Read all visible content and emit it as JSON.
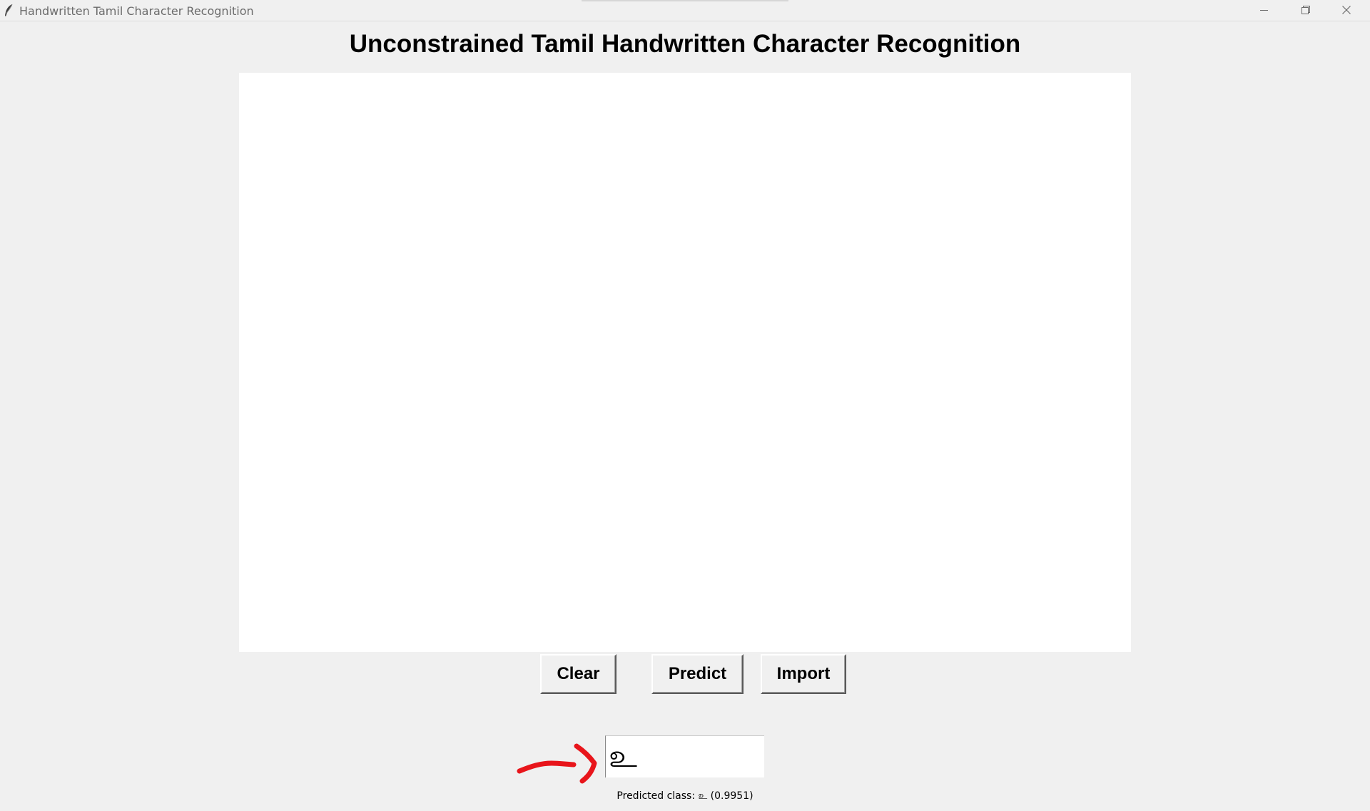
{
  "window": {
    "title": "Handwritten Tamil Character Recognition",
    "controls": [
      "minimize-icon",
      "restore-icon",
      "close-icon"
    ]
  },
  "heading": "Unconstrained Tamil Handwritten Character Recognition",
  "canvas": {
    "background": "#ffffff"
  },
  "buttons": {
    "clear": "Clear",
    "predict": "Predict",
    "import": "Import"
  },
  "result": {
    "character": "உ",
    "predicted_label": "Predicted class: உ (0.9951)"
  },
  "annotation": {
    "icon": "red-arrow-icon",
    "color": "#e8151b"
  },
  "colors": {
    "window_bg": "#f0f0f0",
    "canvas_bg": "#ffffff"
  }
}
